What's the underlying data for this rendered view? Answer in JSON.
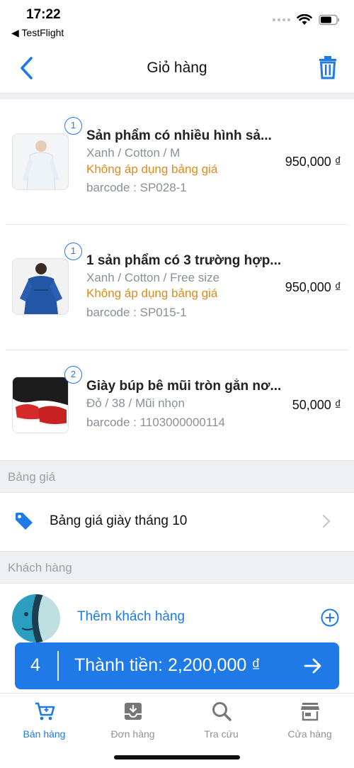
{
  "status_bar": {
    "time": "17:22",
    "back_app": "◀ TestFlight"
  },
  "header": {
    "title": "Giỏ hàng",
    "back_icon": "chevron-left-icon",
    "trash_icon": "trash-icon"
  },
  "colors": {
    "accent": "#1f7ae8",
    "warning": "#e08a1a",
    "muted": "#8a8f98"
  },
  "cart": {
    "items": [
      {
        "qty": "1",
        "name": "Sản phẩm có nhiều hình sả...",
        "variant": "Xanh / Cotton / M",
        "price_note": "Không áp dụng bảng giá",
        "barcode": "barcode : SP028-1",
        "price": "950,000 ₫"
      },
      {
        "qty": "1",
        "name": "1 sản phẩm có 3 trường hợp...",
        "variant": "Xanh / Cotton / Free size",
        "price_note": "Không áp dụng bảng giá",
        "barcode": "barcode : SP015-1",
        "price": "950,000 ₫"
      },
      {
        "qty": "2",
        "name": "Giày búp bê mũi tròn gắn nơ...",
        "variant": "Đỏ / 38 / Mũi nhọn",
        "price_note": "",
        "barcode": "barcode : 1103000000114",
        "price": "50,000 ₫"
      }
    ]
  },
  "pricelist": {
    "section_title": "Bảng giá",
    "value": "Bảng giá giày tháng 10"
  },
  "customer": {
    "section_title": "Khách hàng",
    "add_label": "Thêm khách hàng"
  },
  "checkout": {
    "count": "4",
    "total_label": "Thành tiền: 2,200,000 ₫"
  },
  "tabs": [
    {
      "label": "Bán hàng",
      "icon": "cart-icon",
      "active": true
    },
    {
      "label": "Đơn hàng",
      "icon": "inbox-download-icon",
      "active": false
    },
    {
      "label": "Tra cứu",
      "icon": "search-icon",
      "active": false
    },
    {
      "label": "Cửa hàng",
      "icon": "store-icon",
      "active": false
    }
  ]
}
